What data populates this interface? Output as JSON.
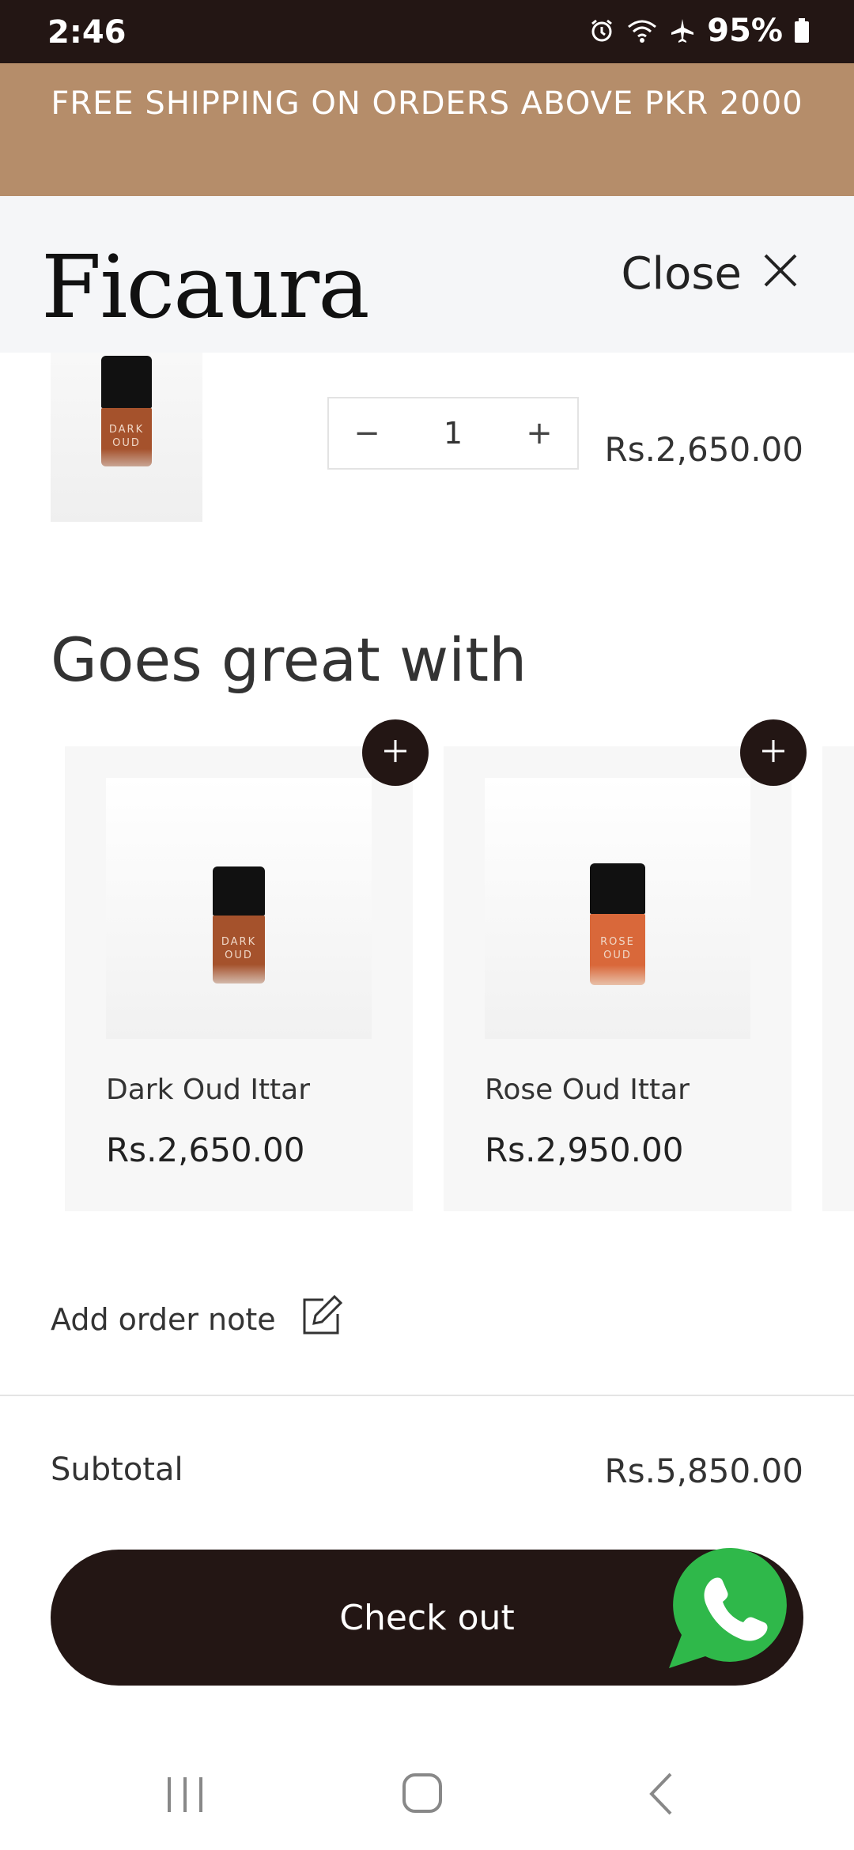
{
  "status_bar": {
    "time": "2:46",
    "battery": "95%",
    "icons": [
      "alarm-icon",
      "wifi-icon",
      "airplane-icon",
      "battery-icon"
    ]
  },
  "promo": {
    "text": "FREE SHIPPING ON ORDERS ABOVE PKR 2000"
  },
  "header": {
    "logo_text": "Ficaura",
    "close_label": "Close"
  },
  "cart_item": {
    "bottle_label_line1": "DARK",
    "bottle_label_line2": "OUD",
    "quantity": "1",
    "minus": "−",
    "plus": "+",
    "price": "Rs.2,650.00"
  },
  "recommendations": {
    "title": "Goes great with",
    "items": [
      {
        "name": "Dark Oud Ittar",
        "price": "Rs.2,650.00",
        "label_line1": "DARK",
        "label_line2": "OUD"
      },
      {
        "name": "Rose Oud Ittar",
        "price": "Rs.2,950.00",
        "label_line1": "ROSE",
        "label_line2": "OUD"
      }
    ]
  },
  "order_note": {
    "label": "Add order note"
  },
  "summary": {
    "subtotal_label": "Subtotal",
    "subtotal_value": "Rs.5,850.00"
  },
  "checkout": {
    "label": "Check out"
  },
  "colors": {
    "status_bar": "#231614",
    "promo_bar": "#b58d6a",
    "header_bg": "#f5f6f8",
    "checkout_button": "#231614",
    "whatsapp_green": "#2fb84a",
    "dark_oud_liquid": "#a5522c",
    "rose_oud_liquid": "#d9683a"
  }
}
